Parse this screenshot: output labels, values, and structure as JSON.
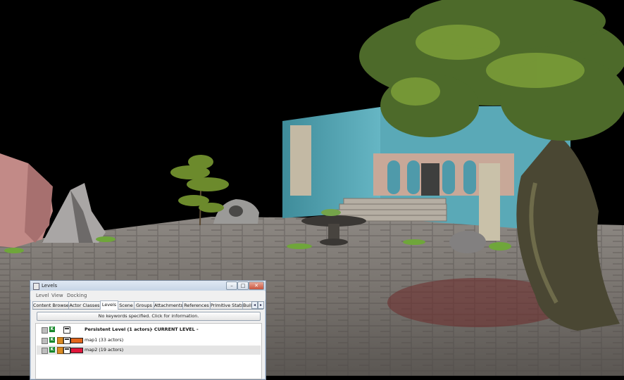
{
  "window": {
    "title": "Levels",
    "menu": [
      "Level",
      "View",
      "Docking"
    ],
    "tabs": [
      "Content Browser",
      "Actor Classes",
      "Levels",
      "Scene",
      "Groups",
      "Attachments",
      "References",
      "Primitive Stats",
      "Build"
    ],
    "active_tab": "Levels",
    "search_text": "No keywords specified.  Click for information.",
    "levels": [
      {
        "name": "Persistent Level (1 actors)",
        "suffix": "- CURRENT LEVEL -",
        "color": null
      },
      {
        "name": "map1 (33 actors)",
        "suffix": "",
        "color": "#e3661c"
      },
      {
        "name": "map2 (19 actors)",
        "suffix": "",
        "color": "#e0163a"
      }
    ]
  },
  "colors": {
    "sky": "#000000",
    "stone": "#6f6b66",
    "wall": "#4f9aaa"
  }
}
